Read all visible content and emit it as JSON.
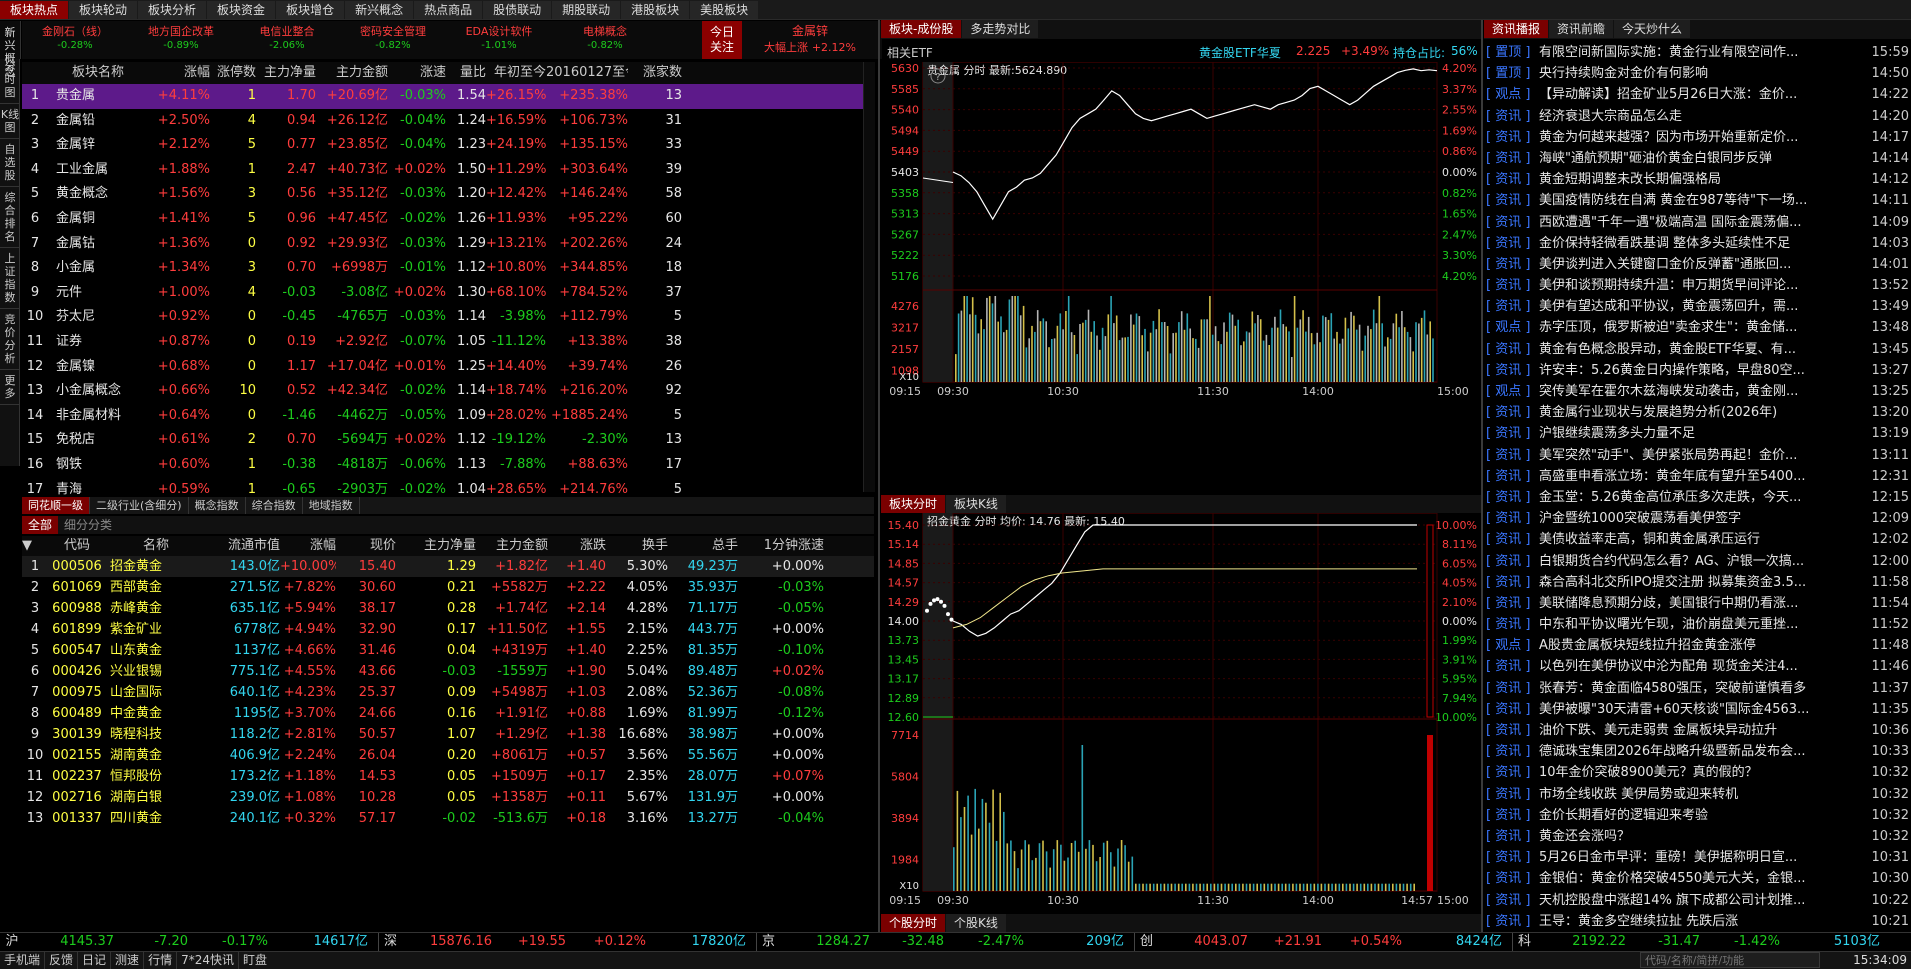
{
  "top_tabs": [
    "板块热点",
    "板块轮动",
    "板块分析",
    "板块资金",
    "板块增仓",
    "新兴概念",
    "热点商品",
    "股债联动",
    "期股联动",
    "港股板块",
    "美股板块"
  ],
  "ticker_label": "新兴\n概念",
  "ticker": [
    {
      "name": "金刚石（线）",
      "pct": "-0.28%"
    },
    {
      "name": "地方国企改革",
      "pct": "-0.89%"
    },
    {
      "name": "电信业整合",
      "pct": "-2.06%"
    },
    {
      "name": "密码安全管理",
      "pct": "-0.82%"
    },
    {
      "name": "EDA设计软件",
      "pct": "-1.01%"
    },
    {
      "name": "电梯概念",
      "pct": "-0.82%"
    }
  ],
  "today_focus": {
    "label": "今日\n关注",
    "name": "金属锌",
    "desc": "大幅上涨",
    "pct": "+2.12%"
  },
  "left_menu": [
    "推荐",
    "分时图",
    "K线图",
    "自选股",
    "综合排名",
    "上证指数",
    "竞价分析",
    "更多"
  ],
  "sector_table": {
    "headers": [
      "板块名称",
      "涨幅",
      "涨停数",
      "主力净量",
      "主力金额",
      "涨速",
      "量比",
      "年初至今",
      "20160127至今",
      "涨家数"
    ],
    "rows": [
      [
        "1",
        "贵金属",
        "+4.11%",
        "1",
        "1.70",
        "+20.69亿",
        "-0.03%",
        "1.54",
        "+26.15%",
        "+235.38%",
        "13"
      ],
      [
        "2",
        "金属铅",
        "+2.50%",
        "4",
        "0.94",
        "+26.12亿",
        "-0.04%",
        "1.24",
        "+16.59%",
        "+106.73%",
        "31"
      ],
      [
        "3",
        "金属锌",
        "+2.12%",
        "5",
        "0.77",
        "+23.85亿",
        "-0.04%",
        "1.23",
        "+24.19%",
        "+135.15%",
        "33"
      ],
      [
        "4",
        "工业金属",
        "+1.88%",
        "1",
        "2.47",
        "+40.73亿",
        "+0.02%",
        "1.50",
        "+11.29%",
        "+303.64%",
        "39"
      ],
      [
        "5",
        "黄金概念",
        "+1.56%",
        "3",
        "0.56",
        "+35.12亿",
        "-0.03%",
        "1.20",
        "+12.42%",
        "+146.24%",
        "58"
      ],
      [
        "6",
        "金属铜",
        "+1.41%",
        "5",
        "0.96",
        "+47.45亿",
        "-0.02%",
        "1.26",
        "+11.93%",
        "+95.22%",
        "60"
      ],
      [
        "7",
        "金属钴",
        "+1.36%",
        "0",
        "0.92",
        "+29.93亿",
        "-0.03%",
        "1.29",
        "+13.21%",
        "+202.26%",
        "24"
      ],
      [
        "8",
        "小金属",
        "+1.34%",
        "3",
        "0.70",
        "+6998万",
        "-0.01%",
        "1.12",
        "+10.80%",
        "+344.85%",
        "18"
      ],
      [
        "9",
        "元件",
        "+1.00%",
        "4",
        "-0.03",
        "-3.08亿",
        "+0.02%",
        "1.30",
        "+68.10%",
        "+784.52%",
        "37"
      ],
      [
        "10",
        "芬太尼",
        "+0.92%",
        "0",
        "-0.45",
        "-4765万",
        "-0.03%",
        "1.14",
        "-3.98%",
        "+112.79%",
        "5"
      ],
      [
        "11",
        "证券",
        "+0.87%",
        "0",
        "0.19",
        "+2.92亿",
        "-0.07%",
        "1.05",
        "-11.12%",
        "+13.38%",
        "38"
      ],
      [
        "12",
        "金属镍",
        "+0.68%",
        "0",
        "1.17",
        "+17.04亿",
        "+0.01%",
        "1.25",
        "+14.40%",
        "+39.74%",
        "26"
      ],
      [
        "13",
        "小金属概念",
        "+0.66%",
        "10",
        "0.52",
        "+42.34亿",
        "-0.02%",
        "1.14",
        "+18.74%",
        "+216.20%",
        "92"
      ],
      [
        "14",
        "非金属材料",
        "+0.64%",
        "0",
        "-1.46",
        "-4462万",
        "-0.05%",
        "1.09",
        "+28.02%",
        "+1885.24%",
        "5"
      ],
      [
        "15",
        "免税店",
        "+0.61%",
        "2",
        "0.70",
        "-5694万",
        "+0.02%",
        "1.12",
        "-19.12%",
        "-2.30%",
        "13"
      ],
      [
        "16",
        "钢铁",
        "+0.60%",
        "1",
        "-0.38",
        "-4818万",
        "-0.06%",
        "1.13",
        "-7.88%",
        "+88.63%",
        "17"
      ],
      [
        "17",
        "青海",
        "+0.59%",
        "1",
        "-0.65",
        "-2903万",
        "-0.02%",
        "1.04",
        "+28.65%",
        "+214.76%",
        "5"
      ]
    ]
  },
  "sector_tabs": [
    "同花顺一级",
    "二级行业(含细分)",
    "概念指数",
    "综合指数",
    "地域指数"
  ],
  "stock_tabs": [
    "全部",
    "细分分类"
  ],
  "stock_table": {
    "headers": [
      "代码",
      "名称",
      "流通市值",
      "涨幅",
      "现价",
      "主力净量",
      "主力金额",
      "涨跌",
      "换手",
      "总手",
      "1分钟涨速"
    ],
    "rows": [
      [
        "1",
        "000506",
        "招金黄金",
        "143.0亿",
        "+10.00%",
        "15.40",
        "1.29",
        "+1.82亿",
        "+1.40",
        "5.30%",
        "49.23万",
        "+0.00%"
      ],
      [
        "2",
        "601069",
        "西部黄金",
        "271.5亿",
        "+7.82%",
        "30.60",
        "0.21",
        "+5582万",
        "+2.22",
        "4.05%",
        "35.93万",
        "-0.03%"
      ],
      [
        "3",
        "600988",
        "赤峰黄金",
        "635.1亿",
        "+5.94%",
        "38.17",
        "0.28",
        "+1.74亿",
        "+2.14",
        "4.28%",
        "71.17万",
        "-0.05%"
      ],
      [
        "4",
        "601899",
        "紫金矿业",
        "6778亿",
        "+4.94%",
        "32.90",
        "0.17",
        "+11.50亿",
        "+1.55",
        "2.15%",
        "443.7万",
        "+0.00%"
      ],
      [
        "5",
        "600547",
        "山东黄金",
        "1137亿",
        "+4.66%",
        "31.46",
        "0.04",
        "+4319万",
        "+1.40",
        "2.25%",
        "81.35万",
        "-0.10%"
      ],
      [
        "6",
        "000426",
        "兴业银锡",
        "775.1亿",
        "+4.55%",
        "43.66",
        "-0.03",
        "-1559万",
        "+1.90",
        "5.04%",
        "89.48万",
        "+0.02%"
      ],
      [
        "7",
        "000975",
        "山金国际",
        "640.1亿",
        "+4.23%",
        "25.37",
        "0.09",
        "+5498万",
        "+1.03",
        "2.08%",
        "52.36万",
        "-0.08%"
      ],
      [
        "8",
        "600489",
        "中金黄金",
        "1195亿",
        "+3.70%",
        "24.66",
        "0.16",
        "+1.91亿",
        "+0.88",
        "1.69%",
        "81.99万",
        "-0.12%"
      ],
      [
        "9",
        "300139",
        "晓程科技",
        "118.2亿",
        "+2.81%",
        "50.57",
        "1.07",
        "+1.29亿",
        "+1.38",
        "16.68%",
        "38.98万",
        "+0.00%"
      ],
      [
        "10",
        "002155",
        "湖南黄金",
        "406.9亿",
        "+2.24%",
        "26.04",
        "0.20",
        "+8061万",
        "+0.57",
        "3.56%",
        "55.56万",
        "+0.00%"
      ],
      [
        "11",
        "002237",
        "恒邦股份",
        "173.2亿",
        "+1.18%",
        "14.53",
        "0.05",
        "+1509万",
        "+0.17",
        "2.35%",
        "28.07万",
        "+0.07%"
      ],
      [
        "12",
        "002716",
        "湖南白银",
        "239.0亿",
        "+1.08%",
        "10.28",
        "0.05",
        "+1358万",
        "+0.11",
        "5.67%",
        "131.9万",
        "+0.00%"
      ],
      [
        "13",
        "001337",
        "四川黄金",
        "240.1亿",
        "+0.32%",
        "57.17",
        "-0.02",
        "-513.6万",
        "+0.18",
        "3.16%",
        "13.27万",
        "-0.04%"
      ]
    ]
  },
  "mid_tabs_top": [
    "板块-成份股",
    "多走势对比"
  ],
  "etf": {
    "left": "相关ETF",
    "name": "黄金股ETF华夏",
    "price": "2.225",
    "pct": "+3.49%",
    "hold_label": "持仓占比:",
    "hold": "56%"
  },
  "chart1": {
    "title": "贵金属 分时 最新:5624.890",
    "prices": [
      "5630",
      "5585",
      "5540",
      "5494",
      "5449",
      "5403",
      "5358",
      "5313",
      "5267",
      "5222",
      "5176"
    ],
    "pcts": [
      "4.20%",
      "3.37%",
      "2.55%",
      "1.69%",
      "0.86%",
      "0.00%",
      "0.82%",
      "1.65%",
      "2.47%",
      "3.30%",
      "4.20%"
    ],
    "vol_labels": [
      "4276",
      "3217",
      "2157",
      "1098"
    ],
    "vol_unit": "X10",
    "times": [
      "09:15",
      "09:30",
      "10:30",
      "11:30",
      "14:00",
      "15:00"
    ]
  },
  "mid_tabs_mid": [
    "板块分时",
    "板块K线"
  ],
  "chart2": {
    "title": "招金黄金 分时 均价: 14.76 最新: 15.40",
    "prices": [
      "15.40",
      "15.14",
      "14.85",
      "14.57",
      "14.29",
      "14.00",
      "13.73",
      "13.45",
      "13.17",
      "12.89",
      "12.60"
    ],
    "pcts": [
      "10.00%",
      "8.11%",
      "6.05%",
      "4.05%",
      "2.10%",
      "0.00%",
      "1.99%",
      "3.91%",
      "5.95%",
      "7.94%",
      "10.00%"
    ],
    "vol_labels": [
      "7714",
      "5804",
      "3894",
      "1984"
    ],
    "vol_unit": "X10",
    "times": [
      "09:15",
      "09:30",
      "10:30",
      "11:30",
      "14:00",
      "14:57",
      "15:00"
    ]
  },
  "mid_tabs_bottom": [
    "个股分时",
    "个股K线"
  ],
  "news_tabs": [
    "资讯播报",
    "资讯前瞻",
    "今天炒什么"
  ],
  "news": [
    [
      "置顶",
      "有限空间新国际实施：黄金行业有限空间作...",
      "15:59"
    ],
    [
      "置顶",
      "央行持续购金对金价有何影响",
      "14:50"
    ],
    [
      "观点",
      "【异动解读】招金矿业5月26日大涨：金价...",
      "14:22"
    ],
    [
      "资讯",
      "经济衰退大宗商品怎么走",
      "14:20"
    ],
    [
      "资讯",
      "黄金为何越来越强？因为市场开始重新定价...",
      "14:17"
    ],
    [
      "资讯",
      "海峡\"通航预期\"砸油价黄金白银同步反弹",
      "14:14"
    ],
    [
      "资讯",
      "黄金短期调整未改长期偏强格局",
      "14:12"
    ],
    [
      "资讯",
      "美国疫情防线在自满 黄金在987等待\"下一场...",
      "14:11"
    ],
    [
      "资讯",
      "西欧遭遇\"千年一遇\"极端高温 国际金震荡偏...",
      "14:09"
    ],
    [
      "资讯",
      "金价保持轻微看跌基调 整体多头延续性不足",
      "14:03"
    ],
    [
      "资讯",
      "美伊谈判进入关键窗口金价反弹蓄\"通胀回...",
      "14:01"
    ],
    [
      "资讯",
      "美伊和谈预期持续升温：申万期货早间评论...",
      "13:52"
    ],
    [
      "资讯",
      "美伊有望达成和平协议，黄金震荡回升，需...",
      "13:49"
    ],
    [
      "观点",
      "赤字压顶，俄罗斯被迫\"卖金求生\"：黄金储...",
      "13:48"
    ],
    [
      "资讯",
      "黄金有色概念股异动，黄金股ETF华夏、有...",
      "13:45"
    ],
    [
      "资讯",
      "许安丰：5.26黄金日内操作策略，早盘80空...",
      "13:27"
    ],
    [
      "观点",
      "突传美军在霍尔木兹海峡发动袭击，黄金刚...",
      "13:25"
    ],
    [
      "资讯",
      "黄金属行业现状与发展趋势分析(2026年)",
      "13:20"
    ],
    [
      "资讯",
      "沪银继续震荡多头力量不足",
      "13:19"
    ],
    [
      "资讯",
      "美军突然\"动手\"、美伊紧张局势再起！金价...",
      "13:11"
    ],
    [
      "资讯",
      "高盛重申看涨立场：黄金年底有望升至5400...",
      "12:31"
    ],
    [
      "资讯",
      "金玉堂：5.26黄金高位承压多次走跌，今天...",
      "12:15"
    ],
    [
      "资讯",
      "沪金暨统1000突破震荡看美伊签字",
      "12:09"
    ],
    [
      "资讯",
      "美债收益率走高，铜和黄金属承压运行",
      "12:02"
    ],
    [
      "资讯",
      "白银期货合约代码怎么看？AG、沪银一次搞...",
      "12:00"
    ],
    [
      "资讯",
      "森合高科北交所IPO提交注册 拟募集资金3.5...",
      "11:58"
    ],
    [
      "资讯",
      "美联储降息预期分歧，美国银行中期仍看涨...",
      "11:54"
    ],
    [
      "资讯",
      "中东和平协议曙光乍现，油价崩盘美元重挫...",
      "11:52"
    ],
    [
      "观点",
      "A股贵金属板块短线拉升招金黄金涨停",
      "11:48"
    ],
    [
      "资讯",
      "以色列在美伊协议中沦为配角 现货金关注4...",
      "11:46"
    ],
    [
      "资讯",
      "张春芳：黄金面临4580强压，突破前谨慎看多",
      "11:37"
    ],
    [
      "资讯",
      "美伊被曝\"30天清雷+60天核谈\"国际金4563...",
      "11:35"
    ],
    [
      "资讯",
      "油价下跌、美元走弱贵 金属板块异动拉升",
      "10:36"
    ],
    [
      "资讯",
      "德诚珠宝集团2026年战略升级暨新品发布会...",
      "10:33"
    ],
    [
      "资讯",
      "10年金价突破8900美元？真的假的？",
      "10:32"
    ],
    [
      "资讯",
      "市场全线收跌 美伊局势或迎来转机",
      "10:32"
    ],
    [
      "资讯",
      "金价长期看好的逻辑迎来考验",
      "10:32"
    ],
    [
      "资讯",
      "黄金还会涨吗？",
      "10:32"
    ],
    [
      "资讯",
      "5月26日金市早评：重磅！美伊据称明日宣...",
      "10:31"
    ],
    [
      "资讯",
      "金银伯：黄金价格突破4550美元大关，金银...",
      "10:30"
    ],
    [
      "资讯",
      "天机控股盘中涨超14% 旗下成都公司计划推...",
      "10:22"
    ],
    [
      "资讯",
      "王导：黄金多空继续拉扯 先跌后涨",
      "10:21"
    ]
  ],
  "index_bar": [
    {
      "name": "沪",
      "val": "4145.37",
      "chg": "-7.20",
      "pct": "-0.17%",
      "amt": "14617亿"
    },
    {
      "name": "深",
      "val": "15876.16",
      "chg": "+19.55",
      "pct": "+0.12%",
      "amt": "17820亿"
    },
    {
      "name": "京",
      "val": "1284.27",
      "chg": "-32.48",
      "pct": "-2.47%",
      "amt": "209亿"
    },
    {
      "name": "创",
      "val": "4043.07",
      "chg": "+21.91",
      "pct": "+0.54%",
      "amt": "8424亿"
    },
    {
      "name": "科",
      "val": "2192.22",
      "chg": "-31.47",
      "pct": "-1.42%",
      "amt": "5103亿"
    }
  ],
  "status_items": [
    "手机端",
    "反馈",
    "日记",
    "测速",
    "行情",
    "7*24快讯",
    "盯盘"
  ],
  "search_placeholder": "代码/名称/简拼/功能",
  "clock": "15:34:09"
}
